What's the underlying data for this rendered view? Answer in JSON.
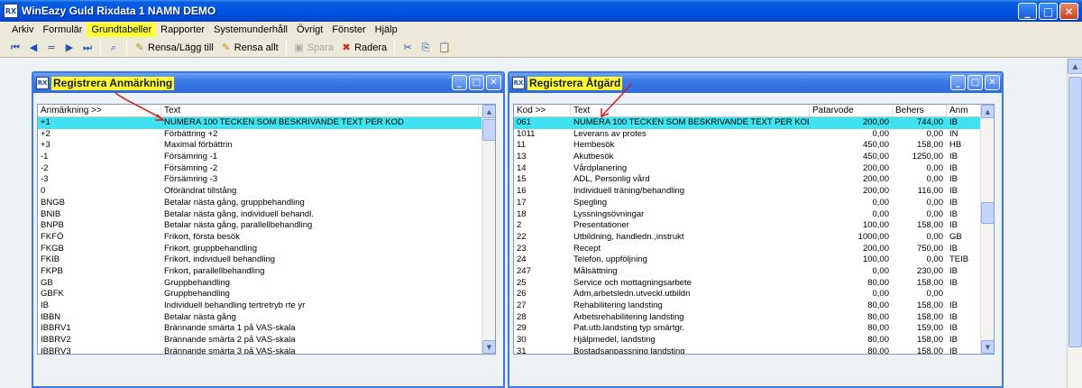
{
  "window": {
    "title": "WinEazy Guld Rixdata 1 NAMN DEMO",
    "icon_text": "RX"
  },
  "menu": [
    {
      "label": "Arkiv",
      "active": false
    },
    {
      "label": "Formulär",
      "active": false
    },
    {
      "label": "Grundtabeller",
      "active": true
    },
    {
      "label": "Rapporter",
      "active": false
    },
    {
      "label": "Systemunderhåll",
      "active": false
    },
    {
      "label": "Övrigt",
      "active": false
    },
    {
      "label": "Fönster",
      "active": false
    },
    {
      "label": "Hjälp",
      "active": false
    }
  ],
  "toolbar": {
    "rensa_lagg_till": "Rensa/Lägg till",
    "rensa_allt": "Rensa allt",
    "spara": "Spara",
    "radera": "Radera"
  },
  "anmarkning": {
    "title": "Registrera Anmärkning",
    "columns": [
      "Anmärkning >>",
      "Text"
    ],
    "rows": [
      [
        "+1",
        "NUMERA 100 TECKEN SOM BESKRIVANDE TEXT PER KOD"
      ],
      [
        "+2",
        "Förbättring +2"
      ],
      [
        "+3",
        "Maximal förbättrin"
      ],
      [
        "-1",
        "Försämring -1"
      ],
      [
        "-2",
        "Försämring -2"
      ],
      [
        "-3",
        "Försämring -3"
      ],
      [
        "0",
        "Oförändrat tillstång"
      ],
      [
        "BNGB",
        "Betalar nästa gång, gruppbehandling"
      ],
      [
        "BNIB",
        "Betalar nästa gång, individuell behandl."
      ],
      [
        "BNPB",
        "Betalar nästa gång, parallellbehandling"
      ],
      [
        "FKFÖ",
        "Frikort, första besök"
      ],
      [
        "FKGB",
        "Frikort, gruppbehandling"
      ],
      [
        "FKIB",
        "Frikort, individuell behandling"
      ],
      [
        "FKPB",
        "Frikort, parallellbehandling"
      ],
      [
        "GB",
        "Gruppbehandling"
      ],
      [
        "GBFK",
        "Gruppbehandling"
      ],
      [
        "IB",
        "Individuell behandling tertretryb rte yr"
      ],
      [
        "IBBN",
        "Betalar nästa gång"
      ],
      [
        "IBBRV1",
        "Brännande smärta 1 på VAS-skala"
      ],
      [
        "IBBRV2",
        "Brännande smärta 2 på VAS-skala"
      ],
      [
        "IBBRV3",
        "Brännande smärta 3 på VAS-skala"
      ]
    ],
    "selected_index": 0
  },
  "atgard": {
    "title": "Registrera Åtgärd",
    "columns": [
      "Kod >>",
      "Text",
      "Patarvode",
      "Behers",
      "Anm"
    ],
    "rows": [
      [
        "061",
        "NUMERA 100 TECKEN SOM BESKRIVANDE TEXT PER KOD",
        "200,00",
        "744,00",
        "IB"
      ],
      [
        "1011",
        "Leverans av protes",
        "0,00",
        "0,00",
        "IN"
      ],
      [
        "11",
        "Hembesök",
        "450,00",
        "158,00",
        "HB"
      ],
      [
        "13",
        "Akutbesök",
        "450,00",
        "1250,00",
        "IB"
      ],
      [
        "14",
        "Vårdplanering",
        "200,00",
        "0,00",
        "IB"
      ],
      [
        "15",
        "ADL, Personlig vård",
        "200,00",
        "0,00",
        "IB"
      ],
      [
        "16",
        "Individuell träning/behandling",
        "200,00",
        "116,00",
        "IB"
      ],
      [
        "17",
        "Spegling",
        "0,00",
        "0,00",
        "IB"
      ],
      [
        "18",
        "Lyssningsövningar",
        "0,00",
        "0,00",
        "IB"
      ],
      [
        "2",
        "Presentationer",
        "100,00",
        "158,00",
        "IB"
      ],
      [
        "22",
        "Utbildning, handledn.,instrukt",
        "1000,00",
        "0,00",
        "GB"
      ],
      [
        "23",
        "Recept",
        "200,00",
        "750,00",
        "IB"
      ],
      [
        "24",
        "Telefon, uppföljning",
        "100,00",
        "0,00",
        "TEIB"
      ],
      [
        "247",
        "Målsättning",
        "0,00",
        "230,00",
        "IB"
      ],
      [
        "25",
        "Service och mottagningsarbete",
        "80,00",
        "158,00",
        "IB"
      ],
      [
        "26",
        "Adm,arbetsledn.utveckl.utbildn",
        "0,00",
        "0,00",
        ""
      ],
      [
        "27",
        "Rehabilitering landsting",
        "80,00",
        "158,00",
        "IB"
      ],
      [
        "28",
        "Arbetsrehabilitering landsting",
        "80,00",
        "158,00",
        "IB"
      ],
      [
        "29",
        "Pat.utb.landsting typ smärtgr.",
        "80,00",
        "159,00",
        "IB"
      ],
      [
        "30",
        "Hjälpmedel, landsting",
        "80,00",
        "158,00",
        "IB"
      ],
      [
        "31",
        "Bostadsanpassning landsting",
        "80,00",
        "158,00",
        "IB"
      ]
    ],
    "selected_index": 0
  },
  "colors": {
    "highlight": "#ffff33",
    "selected_row": "#3fe3f0",
    "annotation_arrow": "#d02020"
  }
}
